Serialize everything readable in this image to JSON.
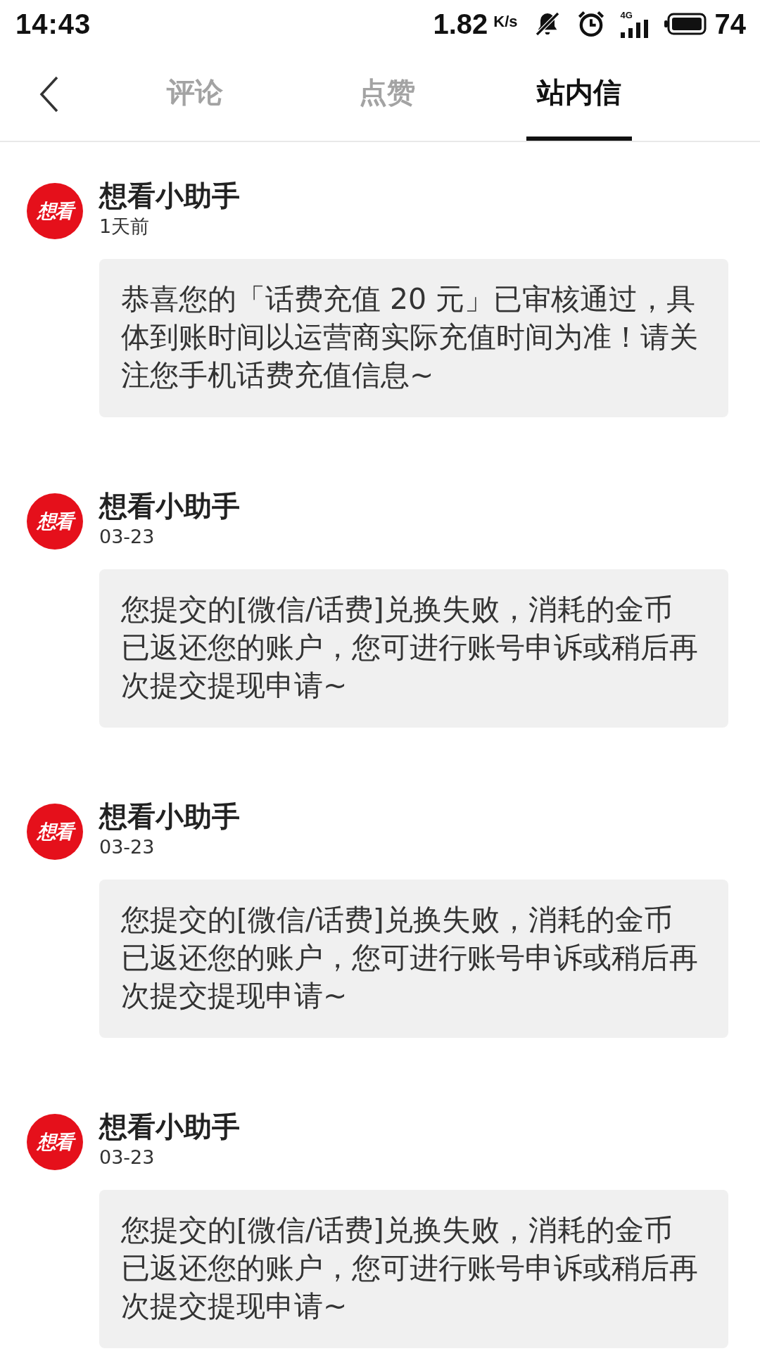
{
  "status_bar": {
    "time": "14:43",
    "speed": "1.82",
    "speed_unit": "K/s",
    "network_type": "4G",
    "battery": "74"
  },
  "tabs": [
    {
      "label": "评论",
      "selected": false
    },
    {
      "label": "点赞",
      "selected": false
    },
    {
      "label": "站内信",
      "selected": true
    }
  ],
  "messages": [
    {
      "avatar_text": "想看",
      "sender": "想看小助手",
      "time": "1天前",
      "text": "恭喜您的「话费充值 20 元」已审核通过，具体到账时间以运营商实际充值时间为准！请关注您手机话费充值信息~"
    },
    {
      "avatar_text": "想看",
      "sender": "想看小助手",
      "time": "03-23",
      "text": "您提交的[微信/话费]兑换失败，消耗的金币已返还您的账户，您可进行账号申诉或稍后再次提交提现申请~"
    },
    {
      "avatar_text": "想看",
      "sender": "想看小助手",
      "time": "03-23",
      "text": "您提交的[微信/话费]兑换失败，消耗的金币已返还您的账户，您可进行账号申诉或稍后再次提交提现申请~"
    },
    {
      "avatar_text": "想看",
      "sender": "想看小助手",
      "time": "03-23",
      "text": "您提交的[微信/话费]兑换失败，消耗的金币已返还您的账户，您可进行账号申诉或稍后再次提交提现申请~"
    }
  ]
}
